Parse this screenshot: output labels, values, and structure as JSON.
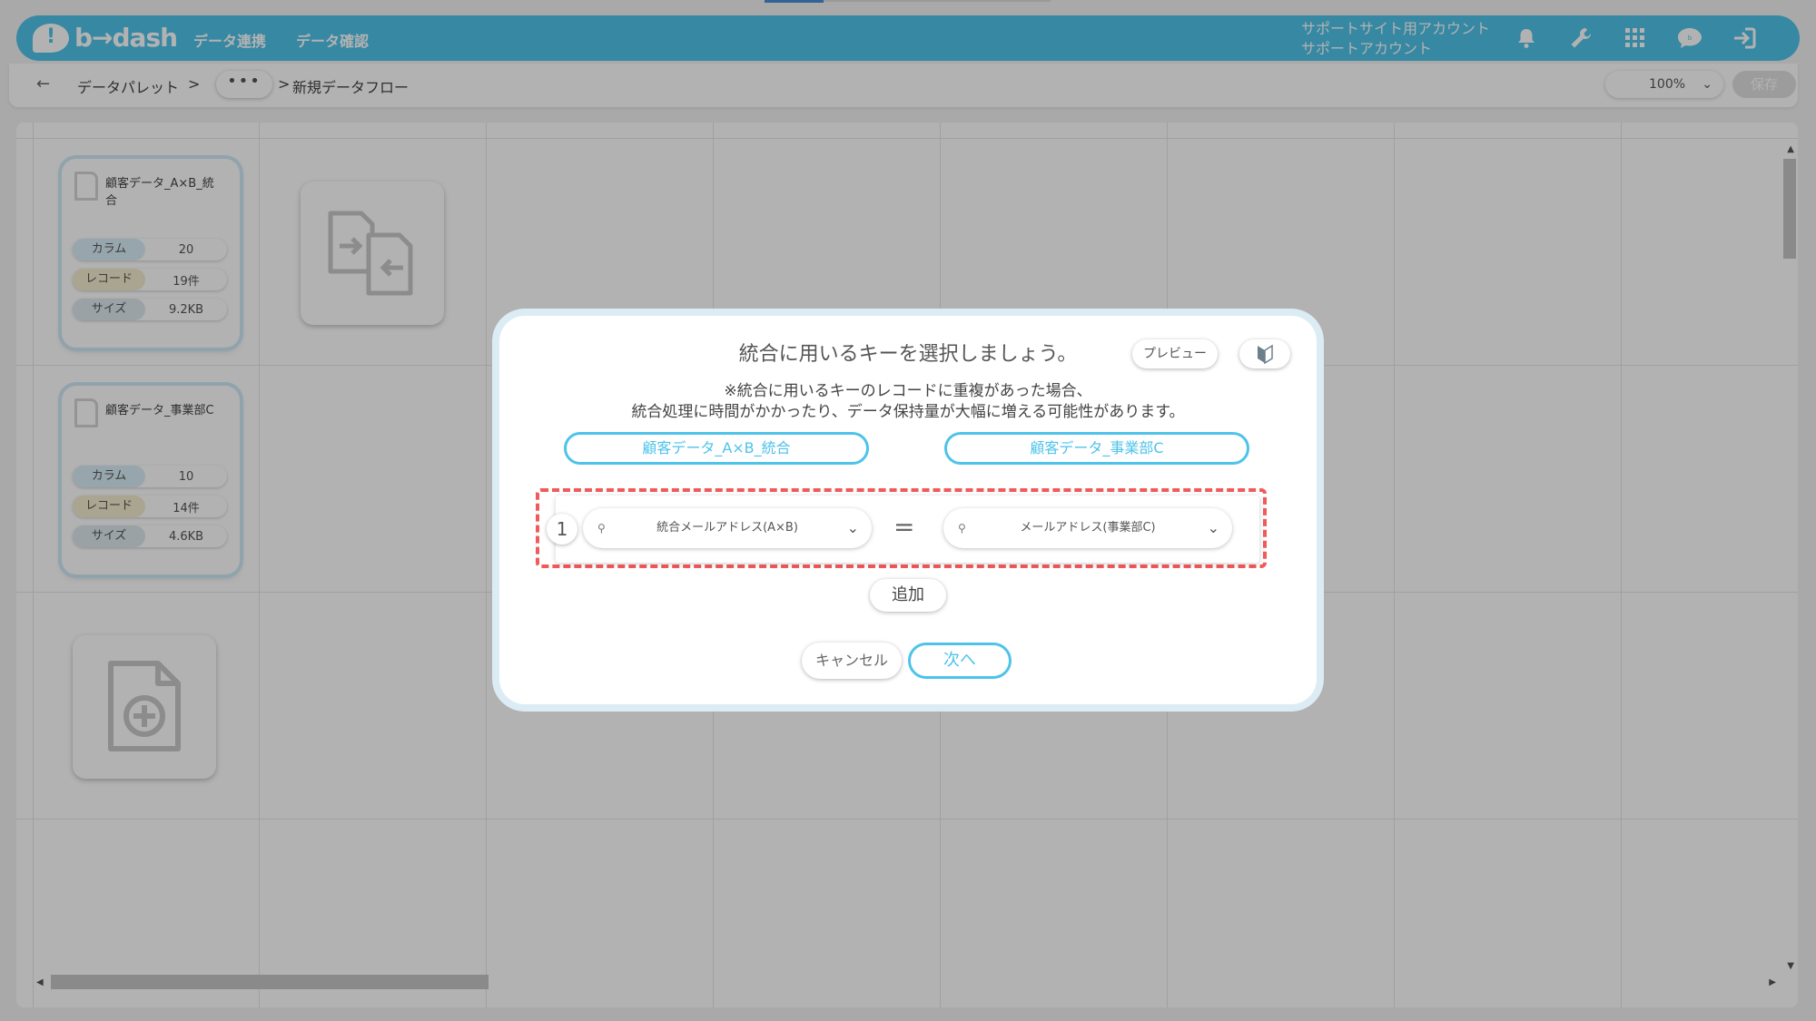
{
  "header": {
    "logo_text": "b→dash",
    "nav": [
      "データ連携",
      "データ確認"
    ],
    "account_line1": "サポートサイト用アカウント",
    "account_line2": "サポートアカウント"
  },
  "breadcrumb": {
    "items": [
      "データパレット",
      "新規データフロー"
    ],
    "separator": ">",
    "ellipsis": "•••"
  },
  "toolbar": {
    "zoom": "100%",
    "save_label": "保存"
  },
  "cards": [
    {
      "title": "顧客データ_A×B_統合",
      "stats": [
        {
          "label": "カラム",
          "value": "20"
        },
        {
          "label": "レコード",
          "value": "19件"
        },
        {
          "label": "サイズ",
          "value": "9.2KB"
        }
      ]
    },
    {
      "title": "顧客データ_事業部C",
      "stats": [
        {
          "label": "カラム",
          "value": "10"
        },
        {
          "label": "レコード",
          "value": "14件"
        },
        {
          "label": "サイズ",
          "value": "4.6KB"
        }
      ]
    }
  ],
  "modal": {
    "title": "統合に用いるキーを選択しましょう。",
    "preview_label": "プレビュー",
    "notice_line1": "※統合に用いるキーのレコードに重複があった場合、",
    "notice_line2": "統合処理に時間がかかったり、データ保持量が大幅に増える可能性があります。",
    "left_source": "顧客データ_A×B_統合",
    "right_source": "顧客データ_事業部C",
    "key_rows": [
      {
        "index": "1",
        "left": "統合メールアドレス(A×B)",
        "op": "=",
        "right": "メールアドレス(事業部C)"
      }
    ],
    "add_label": "追加",
    "cancel_label": "キャンセル",
    "next_label": "次へ"
  },
  "colors": {
    "brand": "#4ec3ea",
    "highlight": "#f05a5a",
    "column_badge": "#d9eef7",
    "record_badge": "#f2eccf",
    "size_badge": "#dde8ee"
  }
}
